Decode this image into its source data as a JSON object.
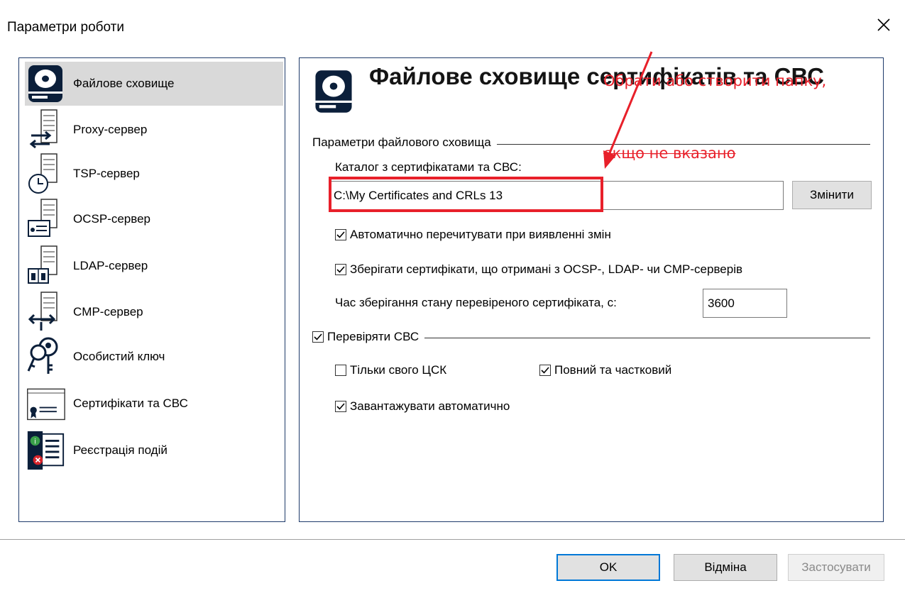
{
  "window": {
    "title": "Параметри роботи"
  },
  "annotation": {
    "line1": "Обрати або створити папку,",
    "line2": "якщо не вказано",
    "color": "#e8202a"
  },
  "sidebar": {
    "items": [
      {
        "label": "Файлове сховище",
        "icon": "hard-drive-icon",
        "selected": true
      },
      {
        "label": "Proxy-сервер",
        "icon": "proxy-server-icon"
      },
      {
        "label": "TSP-сервер",
        "icon": "tsp-server-clock-icon"
      },
      {
        "label": "OCSP-сервер",
        "icon": "ocsp-server-certificate-icon"
      },
      {
        "label": "LDAP-сервер",
        "icon": "ldap-server-directory-icon"
      },
      {
        "label": "CMP-сервер",
        "icon": "cmp-server-arrows-icon"
      },
      {
        "label": "Особистий ключ",
        "icon": "keys-icon"
      },
      {
        "label": "Сертифікати та СВС",
        "icon": "certificate-icon"
      },
      {
        "label": "Реєстрація подій",
        "icon": "event-log-icon"
      }
    ]
  },
  "main": {
    "title": "Файлове сховище сертифікатів та СВС",
    "group1": {
      "label": "Параметри файлового сховища",
      "dir_label": "Каталог з сертифікатами та СВС:",
      "dir_value": "C:\\My Certificates and CRLs 13",
      "change_button": "Змінити",
      "auto_reread": {
        "label": "Автоматично перечитувати при виявленні змін",
        "checked": true
      },
      "save_certs": {
        "label": "Зберігати сертифікати, що отримані з OCSP-, LDAP- чи CMP-серверів",
        "checked": true
      },
      "cache_time_label": "Час зберігання стану перевіреного сертифіката, с:",
      "cache_time_value": "3600"
    },
    "group2": {
      "label": "Перевіряти СВС",
      "checked": true,
      "own_ca_only": {
        "label": "Тільки свого ЦСК",
        "checked": false
      },
      "full_partial": {
        "label": "Повний та частковий",
        "checked": true
      },
      "auto_download": {
        "label": "Завантажувати автоматично",
        "checked": true
      }
    }
  },
  "footer": {
    "ok": "OK",
    "cancel": "Відміна",
    "apply": "Застосувати"
  },
  "colors": {
    "accent": "#0078d7",
    "panel_border": "#1e3a6a",
    "selected_bg": "#d9d9d9"
  }
}
